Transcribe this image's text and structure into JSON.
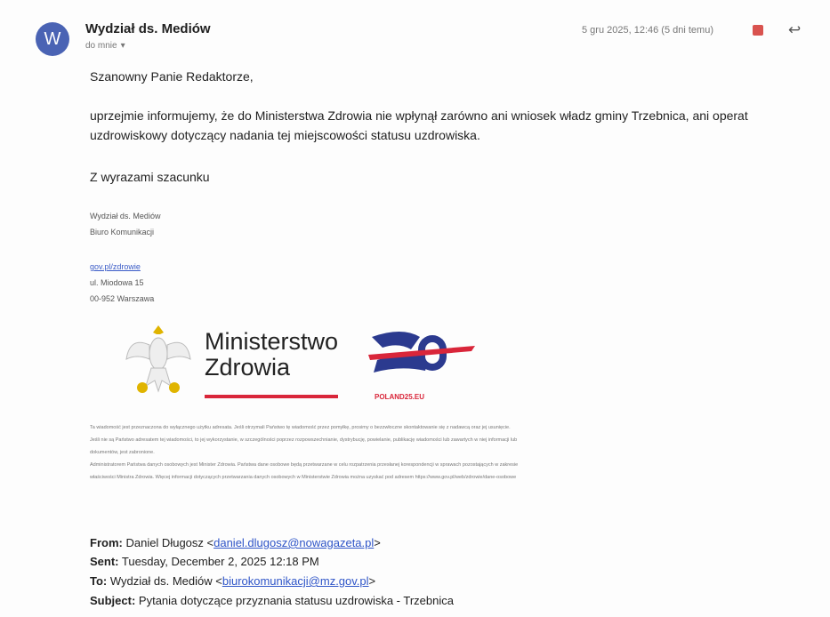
{
  "email": {
    "avatar_letter": "W",
    "sender": "Wydział ds. Mediów",
    "recipient": "do mnie",
    "date": "5 gru 2025, 12:46 (5 dni temu)",
    "greeting": "Szanowny Panie Redaktorze,",
    "body": "uprzejmie informujemy, że do Ministerstwa Zdrowia nie wpłynął zarówno ani wniosek władz gminy Trzebnica, ani operat uzdrowiskowy dotyczący nadania tej miejscowości statusu uzdrowiska.",
    "closing": "Z wyrazami szacunku"
  },
  "signature": {
    "dept": "Wydział ds. Mediów",
    "office": "Biuro Komunikacji",
    "link": "gov.pl/zdrowie",
    "street": "ul. Miodowa 15",
    "city": "00-952 Warszawa"
  },
  "logos": {
    "ministry_line1": "Ministerstwo",
    "ministry_line2": "Zdrowia",
    "eu_label": "POLAND25.EU"
  },
  "disclaimer": [
    "Ta wiadomość jest przeznaczona do wyłącznego użytku adresata. Jeśli otrzymali Państwo tę wiadomość przez pomyłkę, prosimy o bezzwłoczne skontaktowanie się z nadawcą oraz jej usunięcie.",
    "Jeśli nie są Państwo adresatem tej wiadomości, to jej wykorzystanie, w szczególności poprzez rozpowszechnianie, dystrybucję, powielanie, publikację wiadomości lub zawartych w niej informacji lub",
    "dokumentów, jest zabronione.",
    "Administratorem Państwa danych osobowych jest Minister Zdrowia. Państwa dane osobowe będą przetwarzane w celu rozpatrzenia przesłanej korespondencji w sprawach pozostających w zakresie",
    "właściwości Ministra Zdrowia. Więcej informacji dotyczących przetwarzania danych osobowych w Ministerstwie Zdrowia można uzyskać pod adresem https://www.gov.pl/web/zdrowie/dane-osobowe"
  ],
  "quoted": {
    "from_label": "From:",
    "from_name": "Daniel Długosz <",
    "from_email": "daniel.dlugosz@nowagazeta.pl",
    "from_end": ">",
    "sent_label": "Sent:",
    "sent_value": "Tuesday, December 2, 2025 12:18 PM",
    "to_label": "To:",
    "to_name": "Wydział ds. Mediów <",
    "to_email": "biurokomunikacji@mz.gov.pl",
    "to_end": ">",
    "subject_label": "Subject:",
    "subject_value": "Pytania dotyczące przyznania statusu uzdrowiska - Trzebnica"
  },
  "colors": {
    "avatar": "#4a63b4",
    "link": "#2f55c8",
    "accent_red": "#d9263a"
  }
}
